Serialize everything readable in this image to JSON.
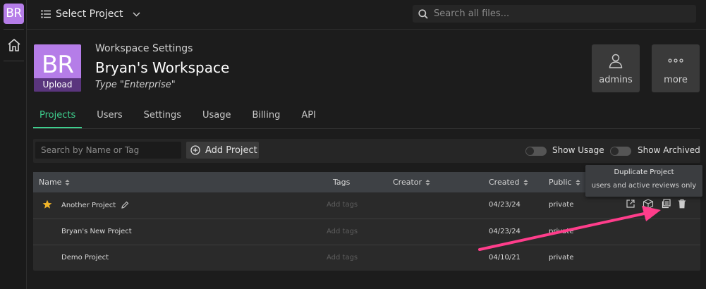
{
  "rail": {
    "logo": "BR"
  },
  "topbar": {
    "select_project": "Select Project",
    "search_placeholder": "Search all files..."
  },
  "workspace": {
    "initials": "BR",
    "upload_label": "Upload",
    "label": "Workspace Settings",
    "name": "Bryan's Workspace",
    "type": "Type \"Enterprise\""
  },
  "header_buttons": {
    "admins": "admins",
    "more": "more"
  },
  "tabs": [
    {
      "label": "Projects",
      "active": true
    },
    {
      "label": "Users"
    },
    {
      "label": "Settings"
    },
    {
      "label": "Usage"
    },
    {
      "label": "Billing"
    },
    {
      "label": "API"
    }
  ],
  "toolbar": {
    "filter_placeholder": "Search by Name or Tag",
    "add_project": "Add Project",
    "show_usage": "Show Usage",
    "show_archived": "Show Archived"
  },
  "table": {
    "columns": {
      "name": "Name",
      "tags": "Tags",
      "creator": "Creator",
      "created": "Created",
      "public": "Public"
    },
    "rows": [
      {
        "name": "Another Project",
        "tags": "Add tags",
        "created": "04/23/24",
        "public": "private",
        "starred": true
      },
      {
        "name": "Bryan's New Project",
        "tags": "Add tags",
        "created": "04/23/24",
        "public": "private"
      },
      {
        "name": "Demo Project",
        "tags": "Add tags",
        "created": "04/10/21",
        "public": "private"
      }
    ]
  },
  "tooltip": {
    "title": "Duplicate Project",
    "subtitle": "users and active reviews only"
  },
  "colors": {
    "accent": "#3ecf8e",
    "avatar": "#b57de8",
    "star": "#f0b429",
    "arrow": "#ff3d8b"
  }
}
